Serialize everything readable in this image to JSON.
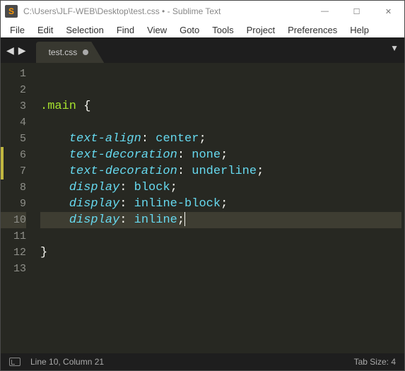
{
  "window": {
    "title": "C:\\Users\\JLF-WEB\\Desktop\\test.css • - Sublime Text",
    "controls": {
      "min": "—",
      "max": "☐",
      "close": "✕"
    }
  },
  "menu": {
    "file": "File",
    "edit": "Edit",
    "selection": "Selection",
    "find": "Find",
    "view": "View",
    "goto": "Goto",
    "tools": "Tools",
    "project": "Project",
    "preferences": "Preferences",
    "help": "Help"
  },
  "tabs": {
    "nav_prev": "◀",
    "nav_next": "▶",
    "dropdown": "▼",
    "active": {
      "label": "test.css"
    }
  },
  "editor": {
    "line_numbers": [
      "1",
      "2",
      "3",
      "4",
      "5",
      "6",
      "7",
      "8",
      "9",
      "10",
      "11",
      "12",
      "13"
    ],
    "highlighted_line_index": 9,
    "modified_line_indices": [
      5,
      6
    ],
    "lines": [
      {
        "t": "blank"
      },
      {
        "t": "blank"
      },
      {
        "t": "open",
        "selector": ".main",
        "brace": "{"
      },
      {
        "t": "blank"
      },
      {
        "t": "decl",
        "prop": "text-align",
        "val": "center"
      },
      {
        "t": "decl",
        "prop": "text-decoration",
        "val": "none"
      },
      {
        "t": "decl",
        "prop": "text-decoration",
        "val": "underline"
      },
      {
        "t": "decl",
        "prop": "display",
        "val": "block"
      },
      {
        "t": "decl",
        "prop": "display",
        "val": "inline-block"
      },
      {
        "t": "decl",
        "prop": "display",
        "val": "inline",
        "caret": true
      },
      {
        "t": "blank"
      },
      {
        "t": "close",
        "brace": "}"
      },
      {
        "t": "blank"
      }
    ]
  },
  "statusbar": {
    "position": "Line 10, Column 21",
    "tab_size": "Tab Size: 4"
  }
}
